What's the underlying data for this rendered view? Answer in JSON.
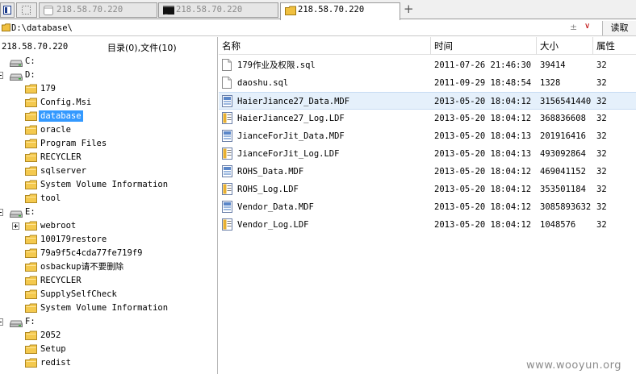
{
  "tabs": [
    {
      "label": "218.58.70.220",
      "icon": "window-icon",
      "active": false
    },
    {
      "label": "218.58.70.220",
      "icon": "terminal-icon",
      "active": false
    },
    {
      "label": "218.58.70.220",
      "icon": "folder-icon",
      "active": true
    }
  ],
  "address": {
    "path": "D:\\database\\",
    "clear_glyph": "±",
    "dropdown_glyph": "∨",
    "read_label": "读取"
  },
  "left": {
    "host": "218.58.70.220",
    "count": "目录(0),文件(10)"
  },
  "tree": [
    {
      "label": "C:",
      "kind": "drive",
      "expander": "none"
    },
    {
      "label": "D:",
      "kind": "drive",
      "expander": "minus"
    },
    {
      "label": "179",
      "kind": "folder",
      "expander": "none"
    },
    {
      "label": "Config.Msi",
      "kind": "folder",
      "expander": "none"
    },
    {
      "label": "database",
      "kind": "folder",
      "expander": "none",
      "selected": true
    },
    {
      "label": "oracle",
      "kind": "folder",
      "expander": "none"
    },
    {
      "label": "Program Files",
      "kind": "folder",
      "expander": "none"
    },
    {
      "label": "RECYCLER",
      "kind": "folder",
      "expander": "none"
    },
    {
      "label": "sqlserver",
      "kind": "folder",
      "expander": "none"
    },
    {
      "label": "System Volume Information",
      "kind": "folder",
      "expander": "none"
    },
    {
      "label": "tool",
      "kind": "folder",
      "expander": "none"
    },
    {
      "label": "E:",
      "kind": "drive",
      "expander": "minus"
    },
    {
      "label": "webroot",
      "kind": "folder",
      "expander": "plus"
    },
    {
      "label": "100179restore",
      "kind": "folder",
      "expander": "none"
    },
    {
      "label": "79a9f5c4cda77fe719f9",
      "kind": "folder",
      "expander": "none"
    },
    {
      "label": "osbackup请不要删除",
      "kind": "folder",
      "expander": "none"
    },
    {
      "label": "RECYCLER",
      "kind": "folder",
      "expander": "none"
    },
    {
      "label": "SupplySelfCheck",
      "kind": "folder",
      "expander": "none"
    },
    {
      "label": "System Volume Information",
      "kind": "folder",
      "expander": "none"
    },
    {
      "label": "F:",
      "kind": "drive",
      "expander": "minus"
    },
    {
      "label": "2052",
      "kind": "folder",
      "expander": "none"
    },
    {
      "label": "Setup",
      "kind": "folder",
      "expander": "none"
    },
    {
      "label": "redist",
      "kind": "folder",
      "expander": "none"
    }
  ],
  "columns": {
    "name": "名称",
    "time": "时间",
    "size": "大小",
    "attr": "属性"
  },
  "files": [
    {
      "name": "179作业及权限.sql",
      "time": "2011-07-26 21:46:30",
      "size": "39414",
      "attr": "32",
      "icon": "text-file-icon"
    },
    {
      "name": "daoshu.sql",
      "time": "2011-09-29 18:48:54",
      "size": "1328",
      "attr": "32",
      "icon": "text-file-icon"
    },
    {
      "name": "HaierJiance27_Data.MDF",
      "time": "2013-05-20 18:04:12",
      "size": "3156541440",
      "attr": "32",
      "icon": "mdf-file-icon",
      "selected": true
    },
    {
      "name": "HaierJiance27_Log.LDF",
      "time": "2013-05-20 18:04:12",
      "size": "368836608",
      "attr": "32",
      "icon": "ldf-file-icon"
    },
    {
      "name": "JianceForJit_Data.MDF",
      "time": "2013-05-20 18:04:13",
      "size": "201916416",
      "attr": "32",
      "icon": "mdf-file-icon"
    },
    {
      "name": "JianceForJit_Log.LDF",
      "time": "2013-05-20 18:04:13",
      "size": "493092864",
      "attr": "32",
      "icon": "ldf-file-icon"
    },
    {
      "name": "ROHS_Data.MDF",
      "time": "2013-05-20 18:04:12",
      "size": "469041152",
      "attr": "32",
      "icon": "mdf-file-icon"
    },
    {
      "name": "ROHS_Log.LDF",
      "time": "2013-05-20 18:04:12",
      "size": "353501184",
      "attr": "32",
      "icon": "ldf-file-icon"
    },
    {
      "name": "Vendor_Data.MDF",
      "time": "2013-05-20 18:04:12",
      "size": "3085893632",
      "attr": "32",
      "icon": "mdf-file-icon"
    },
    {
      "name": "Vendor_Log.LDF",
      "time": "2013-05-20 18:04:12",
      "size": "1048576",
      "attr": "32",
      "icon": "ldf-file-icon"
    }
  ],
  "watermark": "www.wooyun.org"
}
